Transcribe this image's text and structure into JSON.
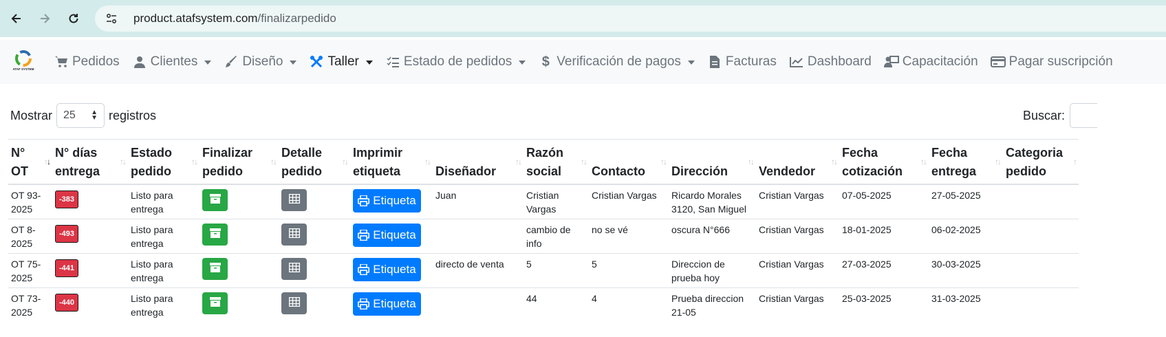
{
  "browser": {
    "url_host": "product.atafsystem.com",
    "url_path": "/finalizarpedido"
  },
  "logo_text": "ATAF SYSTEM",
  "nav": [
    {
      "label": "Pedidos",
      "icon": "cart-icon",
      "dropdown": false,
      "active": false
    },
    {
      "label": "Clientes",
      "icon": "user-icon",
      "dropdown": true,
      "active": false
    },
    {
      "label": "Diseño",
      "icon": "brush-icon",
      "dropdown": true,
      "active": false
    },
    {
      "label": "Taller",
      "icon": "tools-icon",
      "dropdown": true,
      "active": true
    },
    {
      "label": "Estado de pedidos",
      "icon": "list-check-icon",
      "dropdown": true,
      "active": false
    },
    {
      "label": "Verificación de pagos",
      "icon": "dollar-icon",
      "dropdown": true,
      "active": false
    },
    {
      "label": "Facturas",
      "icon": "invoice-icon",
      "dropdown": false,
      "active": false
    },
    {
      "label": "Dashboard",
      "icon": "chart-line-icon",
      "dropdown": false,
      "active": false
    },
    {
      "label": "Capacitación",
      "icon": "training-icon",
      "dropdown": false,
      "active": false
    },
    {
      "label": "Pagar suscripción",
      "icon": "credit-card-icon",
      "dropdown": false,
      "active": false
    }
  ],
  "controls": {
    "show_label": "Mostrar",
    "page_length": "25",
    "records_label": "registros",
    "search_label": "Buscar:"
  },
  "table": {
    "headers": [
      {
        "l1": "N°",
        "l2": "OT"
      },
      {
        "l1": "N° días",
        "l2": "entrega"
      },
      {
        "l1": "Estado",
        "l2": "pedido"
      },
      {
        "l1": "Finalizar",
        "l2": "pedido"
      },
      {
        "l1": "Detalle",
        "l2": "pedido"
      },
      {
        "l1": "Imprimir",
        "l2": "etiqueta"
      },
      {
        "l1": "",
        "l2": "Diseñador"
      },
      {
        "l1": "Razón",
        "l2": "social"
      },
      {
        "l1": "",
        "l2": "Contacto"
      },
      {
        "l1": "",
        "l2": "Dirección"
      },
      {
        "l1": "",
        "l2": "Vendedor"
      },
      {
        "l1": "Fecha",
        "l2": "cotización"
      },
      {
        "l1": "Fecha",
        "l2": "entrega"
      },
      {
        "l1": "Categoria",
        "l2": "pedido"
      }
    ],
    "label_button": "Etiqueta",
    "rows": [
      {
        "ot": "OT 93-\n2025",
        "days": "-383",
        "estado": "Listo para\nentrega",
        "disenador": "Juan",
        "razon": "Cristian Vargas",
        "contacto": "Cristian Vargas",
        "direccion": "Ricardo Morales\n3120, San Miguel",
        "vendedor": "Cristian Vargas",
        "fcot": "07-05-2025",
        "fent": "27-05-2025",
        "cat": ""
      },
      {
        "ot": "OT 8-\n2025",
        "days": "-493",
        "estado": "Listo para\nentrega",
        "disenador": "",
        "razon": "cambio de\ninfo",
        "contacto": "no se vé",
        "direccion": "oscura N°666",
        "vendedor": "Cristian Vargas",
        "fcot": "18-01-2025",
        "fent": "06-02-2025",
        "cat": ""
      },
      {
        "ot": "OT 75-\n2025",
        "days": "-441",
        "estado": "Listo para\nentrega",
        "disenador": "directo de venta",
        "razon": "5",
        "contacto": "5",
        "direccion": "Direccion de\nprueba hoy",
        "vendedor": "Cristian Vargas",
        "fcot": "27-03-2025",
        "fent": "30-03-2025",
        "cat": ""
      },
      {
        "ot": "OT 73-\n2025",
        "days": "-440",
        "estado": "Listo para\nentrega",
        "disenador": "",
        "razon": "44",
        "contacto": "4",
        "direccion": "Prueba direccion\n21-05",
        "vendedor": "Cristian Vargas",
        "fcot": "25-03-2025",
        "fent": "31-03-2025",
        "cat": ""
      }
    ]
  }
}
